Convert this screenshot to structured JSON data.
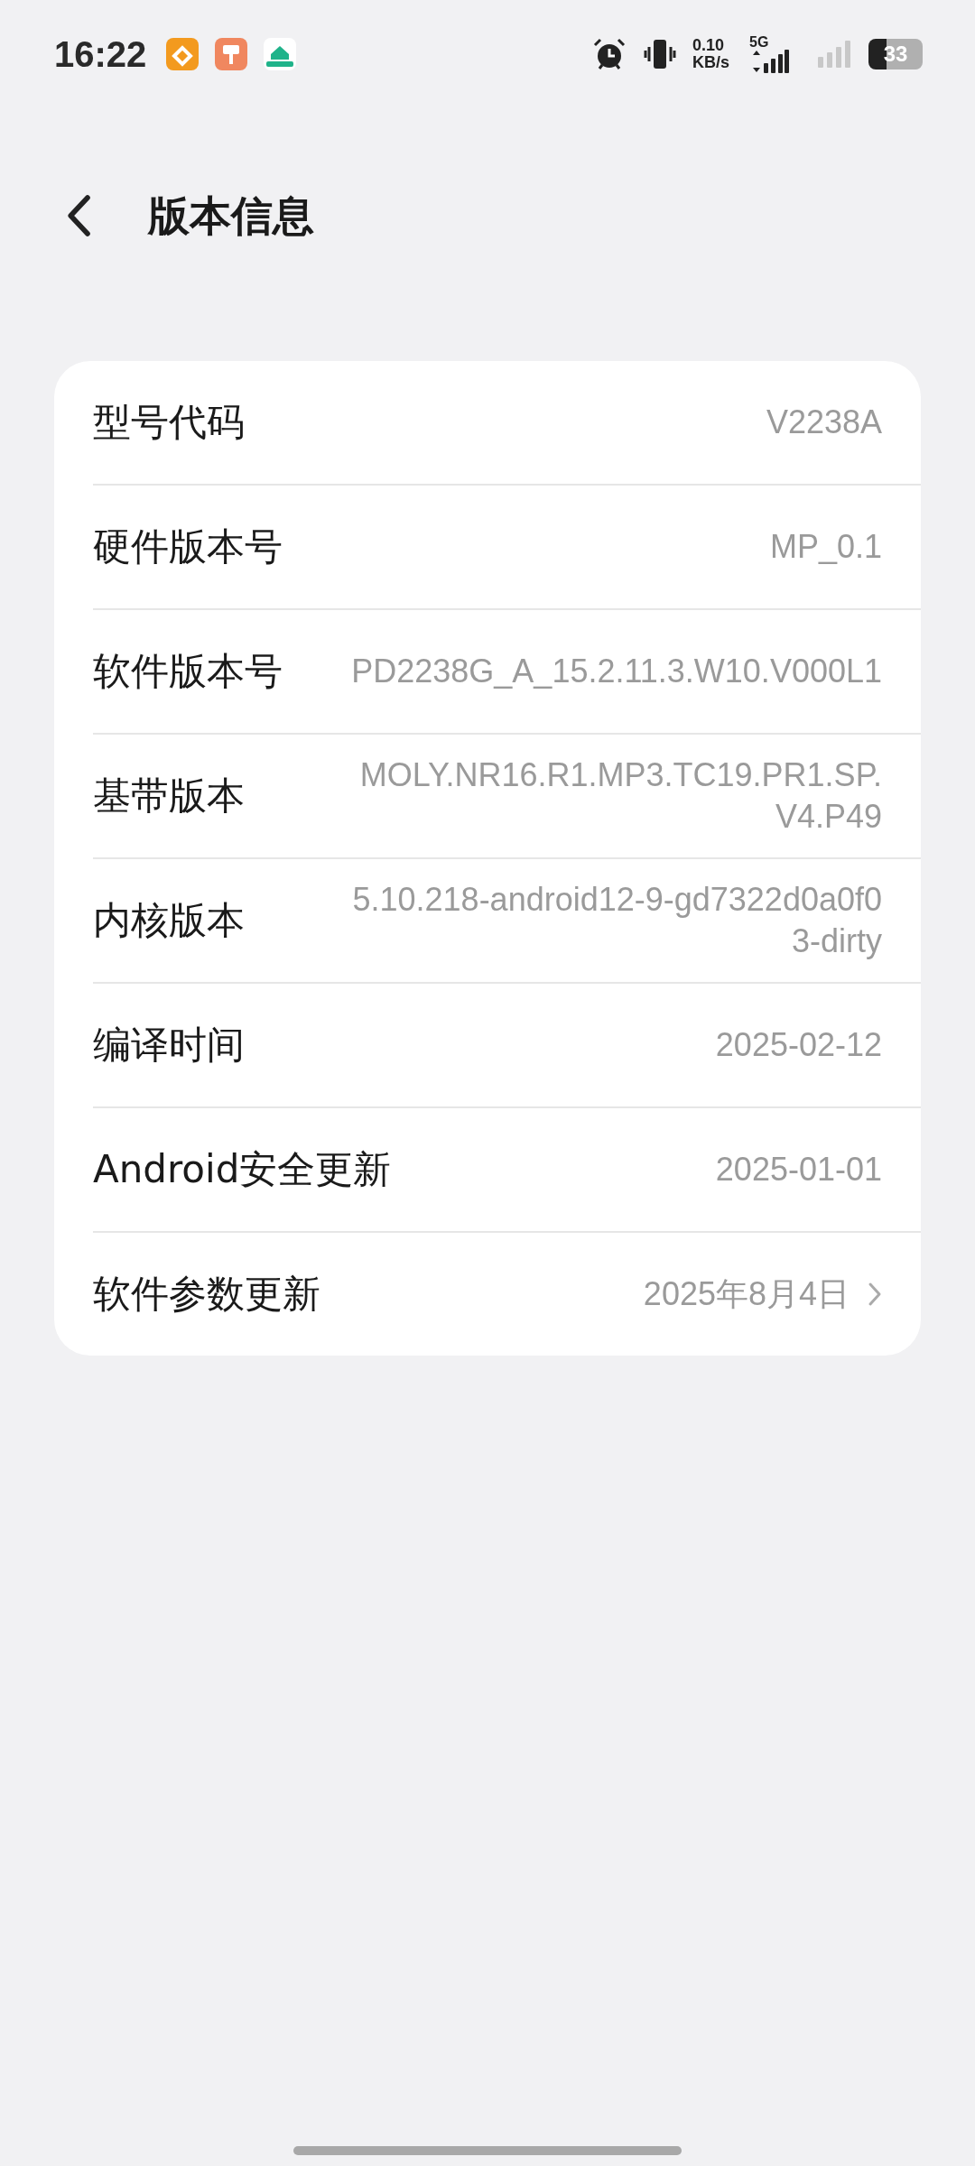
{
  "status_bar": {
    "time": "16:22",
    "speed_value": "0.10",
    "speed_unit": "KB/s",
    "network": "5G",
    "battery": "33"
  },
  "header": {
    "title": "版本信息"
  },
  "rows": [
    {
      "label": "型号代码",
      "value": "V2238A",
      "kind": "plain"
    },
    {
      "label": "硬件版本号",
      "value": "MP_0.1",
      "kind": "plain"
    },
    {
      "label": "软件版本号",
      "value": "PD2238G_A_15.2.11.3.W10.V000L1",
      "kind": "plain"
    },
    {
      "label": "基带版本",
      "value": "MOLY.NR16.R1.MP3.TC19.PR1.SP.V4.P49",
      "kind": "plain"
    },
    {
      "label": "内核版本",
      "value": "5.10.218-android12-9-gd7322d0a0f03-dirty",
      "kind": "plain"
    },
    {
      "label": "编译时间",
      "value": "2025-02-12",
      "kind": "plain"
    },
    {
      "label": "Android安全更新",
      "value": "2025-01-01",
      "kind": "plain"
    },
    {
      "label": "软件参数更新",
      "value": "2025年8月4日",
      "kind": "link"
    }
  ]
}
